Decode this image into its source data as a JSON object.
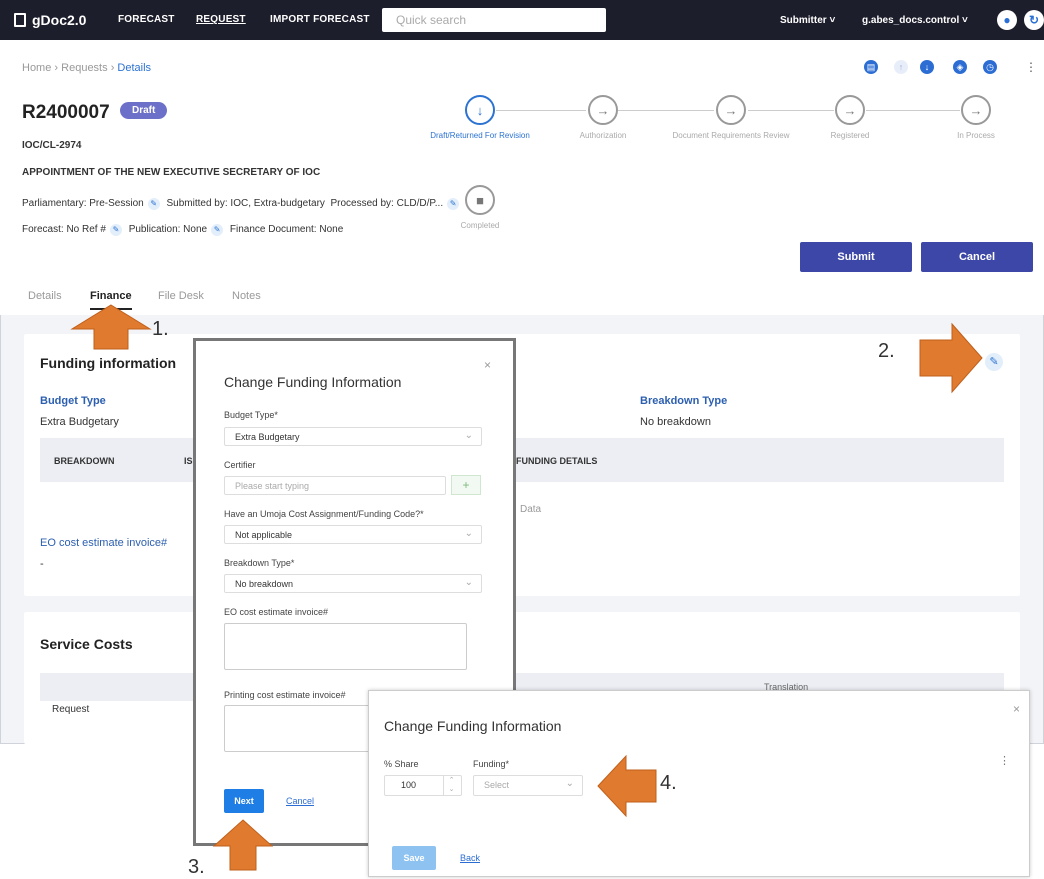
{
  "topbar": {
    "brand": "gDoc2.0",
    "nav": [
      "FORECAST",
      "REQUEST",
      "IMPORT FORECAST"
    ],
    "search_placeholder": "Quick search",
    "role": "Submitter",
    "user": "g.abes_docs.control"
  },
  "breadcrumb": [
    "Home",
    "Requests",
    "Details"
  ],
  "request": {
    "id": "R2400007",
    "status": "Draft",
    "symbol": "IOC/CL-2974",
    "title": "APPOINTMENT OF THE NEW EXECUTIVE SECRETARY OF IOC",
    "line1": {
      "parl": "Parliamentary: Pre-Session",
      "submitted": "Submitted by: IOC, Extra-budgetary",
      "processed": "Processed by: CLD/D/P..."
    },
    "line2": {
      "forecast": "Forecast: No Ref #",
      "publication": "Publication: None",
      "finance": "Finance Document: None"
    }
  },
  "workflow": [
    {
      "label": "Draft/Returned For Revision",
      "icon": "arrow-down"
    },
    {
      "label": "Authorization",
      "icon": "arrow-right"
    },
    {
      "label": "Document Requirements Review",
      "icon": "arrow-right"
    },
    {
      "label": "Registered",
      "icon": "arrow-right"
    },
    {
      "label": "In Process",
      "icon": "arrow-right"
    },
    {
      "label": "Completed",
      "icon": "stop"
    }
  ],
  "actions": {
    "submit": "Submit",
    "cancel": "Cancel"
  },
  "tabs": [
    "Details",
    "Finance",
    "File Desk",
    "Notes"
  ],
  "funding": {
    "title": "Funding information",
    "budget_type_label": "Budget Type",
    "budget_type_value": "Extra Budgetary",
    "breakdown_label": "Breakdown Type",
    "breakdown_value": "No breakdown",
    "table_headers": [
      "BREAKDOWN",
      "IS",
      "FUNDING DETAILS"
    ],
    "no_data": "Data",
    "eo_label": "EO cost estimate invoice#",
    "eo_value": "-"
  },
  "service_costs": {
    "title": "Service Costs",
    "translation_header": "Translation",
    "row_label": "Request"
  },
  "modal1": {
    "title": "Change Funding Information",
    "budget_type_label": "Budget Type*",
    "budget_type_value": "Extra Budgetary",
    "certifier_label": "Certifier",
    "certifier_placeholder": "Please start typing",
    "umoja_label": "Have an Umoja Cost Assignment/Funding Code?*",
    "umoja_value": "Not applicable",
    "breakdown_label": "Breakdown Type*",
    "breakdown_value": "No breakdown",
    "eo_label": "EO cost estimate invoice#",
    "printing_label": "Printing cost estimate invoice#",
    "next": "Next",
    "cancel": "Cancel",
    "close": "×"
  },
  "modal2": {
    "title": "Change Funding Information",
    "share_label": "% Share",
    "share_value": "100",
    "funding_label": "Funding*",
    "funding_placeholder": "Select",
    "save": "Save",
    "back": "Back",
    "close": "×"
  },
  "annotations": [
    "1.",
    "2.",
    "3.",
    "4."
  ],
  "colors": {
    "arrow": "#e07a2e",
    "primary": "#3c47a8",
    "link": "#2c73d2"
  }
}
